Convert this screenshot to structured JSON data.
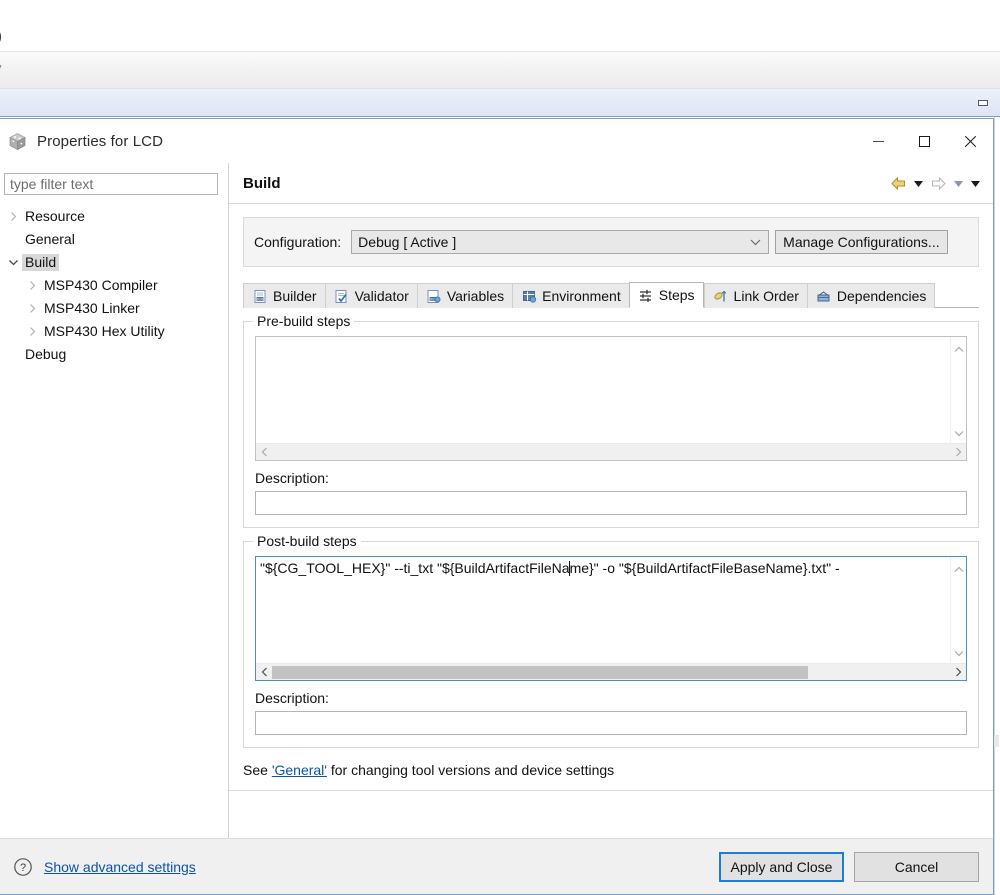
{
  "background": {
    "glyph_left_top": ")",
    "glyph_left_toolbar": "▾",
    "minimize_icon": "minimize-icon"
  },
  "window": {
    "title": "Properties for LCD",
    "icon": "properties-cube-icon",
    "buttons": {
      "minimize": "Minimize",
      "maximize": "Maximize",
      "close": "Close"
    }
  },
  "sidebar": {
    "filter": {
      "placeholder": "type filter text",
      "value": ""
    },
    "items": [
      {
        "label": "Resource",
        "indent": 0,
        "expander": "collapsed",
        "selected": false
      },
      {
        "label": "General",
        "indent": 0,
        "expander": "none",
        "selected": false
      },
      {
        "label": "Build",
        "indent": 0,
        "expander": "expanded",
        "selected": true
      },
      {
        "label": "MSP430 Compiler",
        "indent": 1,
        "expander": "collapsed",
        "selected": false
      },
      {
        "label": "MSP430 Linker",
        "indent": 1,
        "expander": "collapsed",
        "selected": false
      },
      {
        "label": "MSP430 Hex Utility",
        "indent": 1,
        "expander": "collapsed",
        "selected": false
      },
      {
        "label": "Debug",
        "indent": 0,
        "expander": "none",
        "selected": false
      }
    ]
  },
  "page": {
    "title": "Build",
    "nav": {
      "back": "back-arrow-icon",
      "back_menu": "back-dropdown-icon",
      "forward": "forward-arrow-icon",
      "forward_menu": "forward-dropdown-icon",
      "view_menu": "view-menu-dropdown-icon"
    },
    "configuration": {
      "label": "Configuration:",
      "value": "Debug  [ Active ]",
      "options": [
        "Debug  [ Active ]"
      ],
      "manage_button": "Manage Configurations..."
    },
    "tabs": [
      {
        "label": "Builder",
        "icon": "builder-icon",
        "active": false
      },
      {
        "label": "Validator",
        "icon": "validator-icon",
        "active": false
      },
      {
        "label": "Variables",
        "icon": "variables-icon",
        "active": false
      },
      {
        "label": "Environment",
        "icon": "environment-icon",
        "active": false
      },
      {
        "label": "Steps",
        "icon": "steps-icon",
        "active": true
      },
      {
        "label": "Link Order",
        "icon": "link-order-icon",
        "active": false
      },
      {
        "label": "Dependencies",
        "icon": "dependencies-icon",
        "active": false
      }
    ],
    "prebuild": {
      "group_title": "Pre-build steps",
      "steps_value": "",
      "description_label": "Description:",
      "description_value": "",
      "focused": false
    },
    "postbuild": {
      "group_title": "Post-build steps",
      "steps_value_before_caret": "\"${CG_TOOL_HEX}\" --ti_txt \"${BuildArtifactFileNa",
      "steps_value_after_caret": "me}\" -o \"${BuildArtifactFileBaseName}.txt\" -",
      "description_label": "Description:",
      "description_value": "",
      "focused": true,
      "hscroll_thumb_percent": 79
    },
    "note": {
      "prefix": "See ",
      "link": "'General'",
      "suffix": " for changing tool versions and device settings"
    }
  },
  "footer": {
    "help_icon": "help-question-icon",
    "advanced_link": "Show advanced settings",
    "apply_button": "Apply and Close",
    "cancel_button": "Cancel"
  },
  "colors": {
    "accent_blue": "#1a7fd4",
    "link_blue": "#0b54a8",
    "focus_border": "#4a90c4",
    "dialog_bg": "#f0f0f0",
    "selection_gray": "#d8d8d8"
  }
}
